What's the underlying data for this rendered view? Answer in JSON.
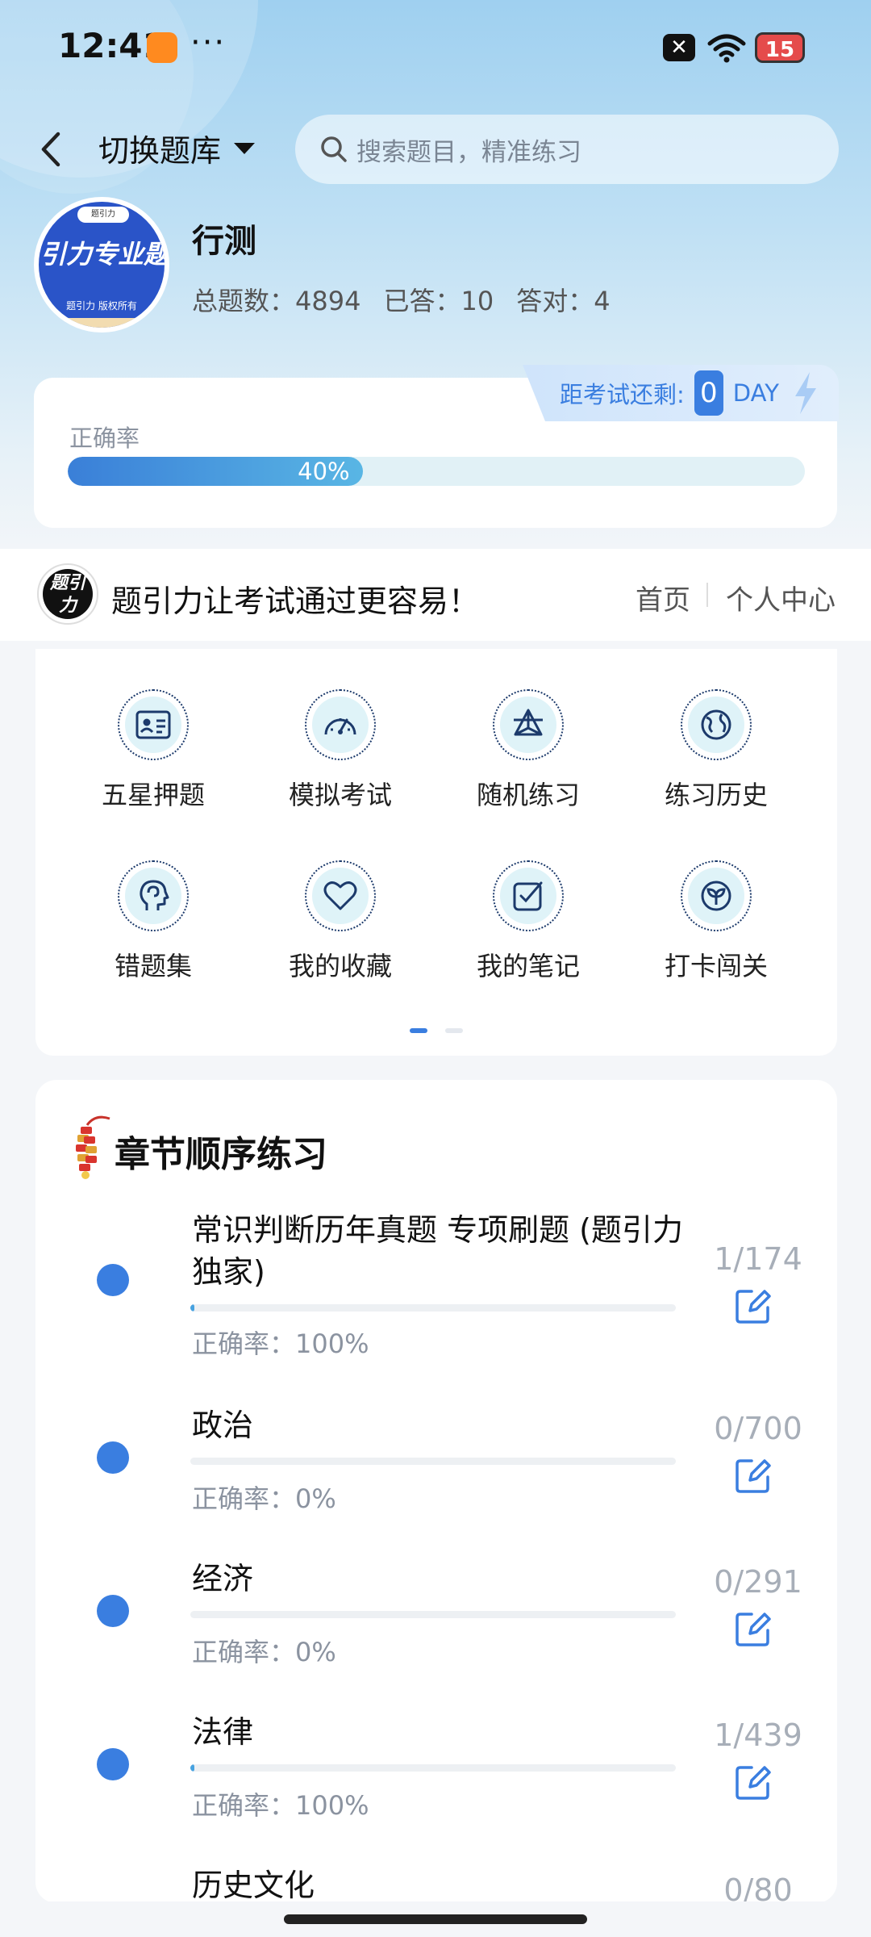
{
  "status_bar": {
    "time": "12:41",
    "dots": "···",
    "x_badge": "✕",
    "battery": "15"
  },
  "header": {
    "switch_label": "切换题库",
    "search_placeholder": "搜索题目，精准练习"
  },
  "profile": {
    "name": "行测",
    "avatar_top": "题引力",
    "avatar_text": "引力专业题",
    "avatar_bottom": "题引力 版权所有",
    "total_label": "总题数：4894",
    "answered_label": "已答：10",
    "correct_label": "答对：4"
  },
  "accuracy": {
    "label": "正确率",
    "percent_text": "40%",
    "fraction": 0.4,
    "exam_label": "距考试还剩:",
    "days": "0",
    "day_unit": "DAY"
  },
  "banner": {
    "logo_text": "题引力",
    "slogan": "题引力让考试通过更容易！",
    "nav_home": "首页",
    "nav_me": "个人中心"
  },
  "grid": [
    {
      "label": "五星押题",
      "icon": "id-card-icon"
    },
    {
      "label": "模拟考试",
      "icon": "speedometer-icon"
    },
    {
      "label": "随机练习",
      "icon": "network-icon"
    },
    {
      "label": "练习历史",
      "icon": "globe-icon"
    },
    {
      "label": "错题集",
      "icon": "head-icon"
    },
    {
      "label": "我的收藏",
      "icon": "heart-icon"
    },
    {
      "label": "我的笔记",
      "icon": "checkbox-icon"
    },
    {
      "label": "打卡闯关",
      "icon": "sprout-icon"
    }
  ],
  "chapters": {
    "title": "章节顺序练习",
    "items": [
      {
        "name": "常识判断历年真题 专项刷题 (题引力独家)",
        "accuracy": "正确率：100%",
        "count": "1/174",
        "progress": 0.0057
      },
      {
        "name": "政治",
        "accuracy": "正确率：0%",
        "count": "0/700",
        "progress": 0
      },
      {
        "name": "经济",
        "accuracy": "正确率：0%",
        "count": "0/291",
        "progress": 0
      },
      {
        "name": "法律",
        "accuracy": "正确率：100%",
        "count": "1/439",
        "progress": 0.0023
      },
      {
        "name": "历史文化",
        "accuracy": "",
        "count": "0/80",
        "progress": 0
      }
    ]
  },
  "colors": {
    "accent": "#3a7ee0",
    "progress": "#47a2e0"
  }
}
